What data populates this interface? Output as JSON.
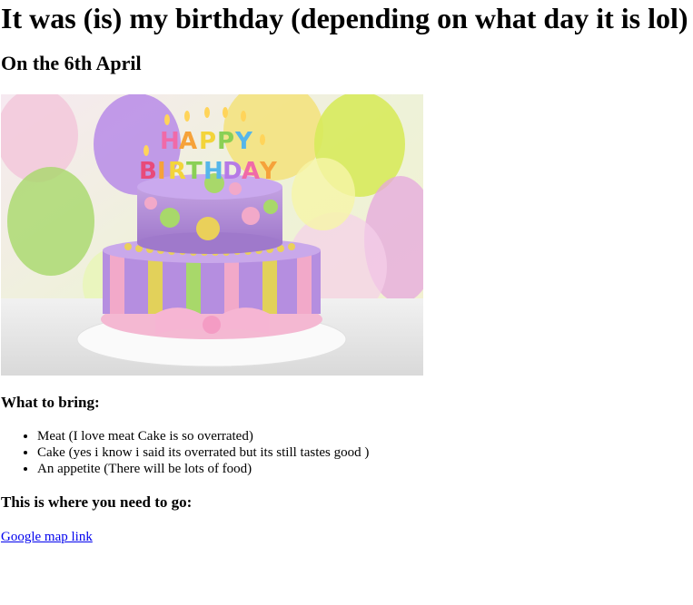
{
  "page": {
    "title": "It was (is) my birthday (depending on what day it is lol)",
    "subtitle": "On the 6th April",
    "image": {
      "description_icon": "birthday-cake-image",
      "candle_letters": "HAPPY BIRTHDAY"
    },
    "bring_heading": "What to bring:",
    "bring_items": [
      "Meat (I love meat Cake is so overrated)",
      "Cake (yes i know i said its overrated but its still tastes good )",
      "An appetite (There will be lots of food)"
    ],
    "where_heading": "This is where you need to go:",
    "map_link_text": "Google map link"
  },
  "colors": {
    "link": "#0000ee"
  }
}
